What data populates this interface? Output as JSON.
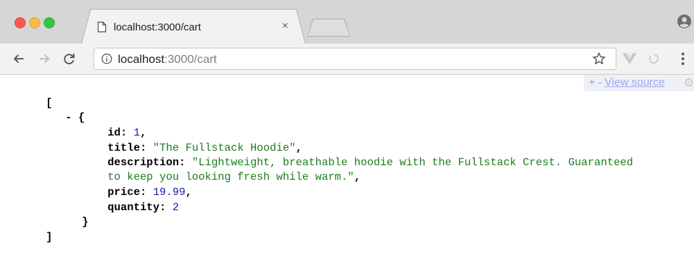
{
  "browser": {
    "tab_title": "localhost:3000/cart",
    "tab_close": "×",
    "url_host": "localhost",
    "url_rest": ":3000/cart"
  },
  "viewer": {
    "toggle_label": "+ -",
    "view_source_label": "View source"
  },
  "json": {
    "open_bracket": "[",
    "item_prefix": "- {",
    "fields": [
      {
        "key": "id:",
        "value": "1",
        "type": "num",
        "suffix": ","
      },
      {
        "key": "title:",
        "value": "\"The Fullstack Hoodie\"",
        "type": "str",
        "suffix": ","
      },
      {
        "key": "description:",
        "value": "\"Lightweight, breathable hoodie with the Fullstack Crest. Guaranteed",
        "type": "str",
        "suffix": ""
      },
      {
        "key": "",
        "value": "to keep you looking fresh while warm.\"",
        "type": "str",
        "suffix": ","
      },
      {
        "key": "price:",
        "value": "19.99",
        "type": "num",
        "suffix": ","
      },
      {
        "key": "quantity:",
        "value": "2",
        "type": "num",
        "suffix": ""
      }
    ],
    "item_close": "}",
    "close_bracket": "]"
  },
  "colors": {
    "number": "#1a1aa6",
    "string": "#1c7d1c",
    "link": "#9aa9f0"
  },
  "icons": {
    "page": "page-icon",
    "info": "info-icon",
    "star": "star-icon",
    "profile": "profile-icon"
  }
}
